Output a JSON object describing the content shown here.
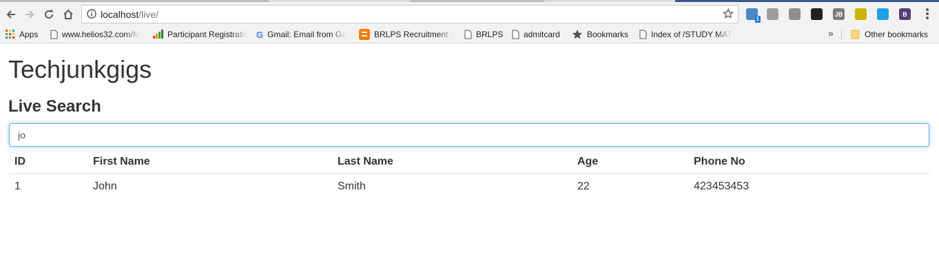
{
  "browser": {
    "url_host": "localhost",
    "url_path": "/live/",
    "extensions": [
      {
        "icon": "globe-extension-icon",
        "color": "#4a86c8",
        "badge": "1"
      },
      {
        "icon": "puzzle-extension-icon",
        "color": "#9e9e9e"
      },
      {
        "icon": "a-extension-icon",
        "color": "#8e8e8e"
      },
      {
        "icon": "square-extension-icon",
        "color": "#202020"
      },
      {
        "icon": "jb-extension-icon",
        "color": "#7a7a7a",
        "text": "JB"
      },
      {
        "icon": "lightning-extension-icon",
        "color": "#c9b400"
      },
      {
        "icon": "cloud-extension-icon",
        "color": "#1da1e4"
      },
      {
        "icon": "bootstrap-extension-icon",
        "color": "#563d7c",
        "text": "B"
      }
    ]
  },
  "bookmarks": [
    {
      "label": "Apps",
      "icon": "apps-grid-icon"
    },
    {
      "label": "www.helios32.com/M",
      "icon": "page-icon"
    },
    {
      "label": "Participant Registratio",
      "icon": "signal-bars-icon"
    },
    {
      "label": "Gmail: Email from Go",
      "icon": "google-icon"
    },
    {
      "label": "BRLPS Recruitment 2(",
      "icon": "blogger-icon"
    },
    {
      "label": "BRLPS",
      "icon": "page-icon"
    },
    {
      "label": "admitcard",
      "icon": "page-icon"
    },
    {
      "label": "Bookmarks",
      "icon": "star-folder-icon"
    },
    {
      "label": "Index of /STUDY MAT",
      "icon": "page-icon"
    },
    {
      "label": "Other bookmarks",
      "icon": "folder-icon"
    }
  ],
  "page": {
    "title": "Techjunkgigs",
    "section_title": "Live Search",
    "search_value": "jo"
  },
  "table": {
    "headers": [
      "ID",
      "First Name",
      "Last Name",
      "Age",
      "Phone No"
    ],
    "rows": [
      [
        "1",
        "John",
        "Smith",
        "22",
        "423453453"
      ]
    ]
  }
}
